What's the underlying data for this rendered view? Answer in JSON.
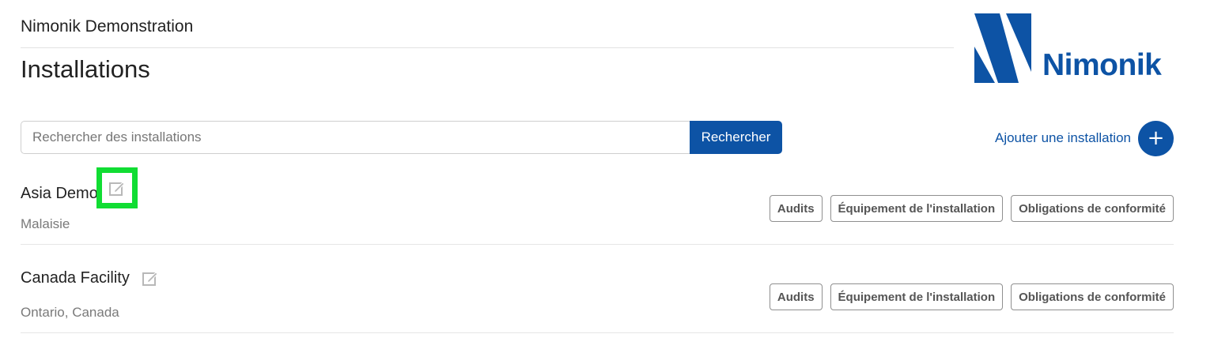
{
  "header": {
    "org_name": "Nimonik Demonstration",
    "page_title": "Installations",
    "logo_text": "Nimonik"
  },
  "search": {
    "placeholder": "Rechercher des installations",
    "value": "",
    "button_label": "Rechercher"
  },
  "add_facility": {
    "link_label": "Ajouter une installation",
    "button_symbol": "+"
  },
  "facilities": [
    {
      "name": "Asia Demo",
      "location": "Malaisie",
      "actions": [
        "Audits",
        "Équipement de l'installation",
        "Obligations de conformité"
      ]
    },
    {
      "name": "Canada Facility",
      "location": "Ontario, Canada",
      "actions": [
        "Audits",
        "Équipement de l'installation",
        "Obligations de conformité"
      ]
    }
  ],
  "colors": {
    "brand": "#0d53a5",
    "highlight": "#11dd33",
    "muted_text": "#7a7a7a"
  },
  "icons": {
    "edit": "edit-icon",
    "add": "plus-icon"
  }
}
